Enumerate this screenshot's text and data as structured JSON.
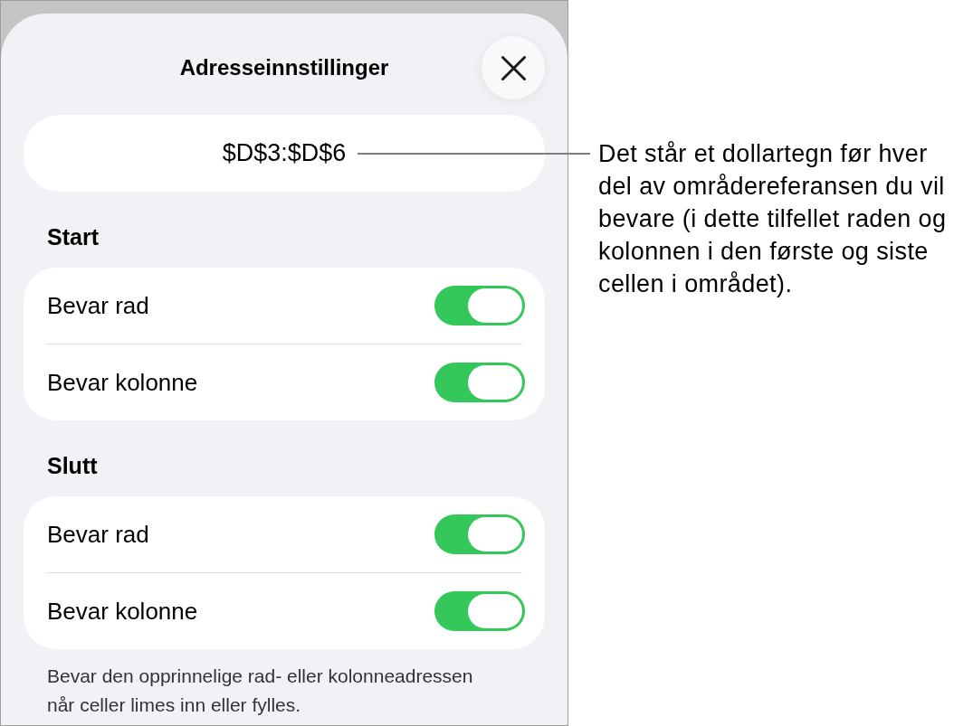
{
  "sheet": {
    "title": "Adresseinnstillinger",
    "address": "$D$3:$D$6",
    "sections": [
      {
        "heading": "Start",
        "rows": [
          {
            "label": "Bevar rad",
            "on": true
          },
          {
            "label": "Bevar kolonne",
            "on": true
          }
        ]
      },
      {
        "heading": "Slutt",
        "rows": [
          {
            "label": "Bevar rad",
            "on": true
          },
          {
            "label": "Bevar kolonne",
            "on": true
          }
        ]
      }
    ],
    "footnote": "Bevar den opprinnelige rad- eller kolonneadressen når celler limes inn eller fylles."
  },
  "callout": "Det står et dollartegn før hver del av områdereferansen du vil bevare (i dette tilfellet raden og kolonnen i den første og siste cellen i området)."
}
